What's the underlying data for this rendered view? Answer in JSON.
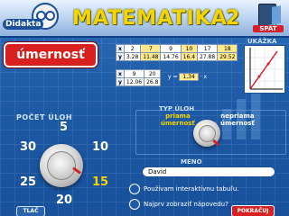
{
  "header": {
    "logo_text": "Didakta",
    "title": "MATEMATIKA",
    "number": "2",
    "exit_label": "SPÄŤ"
  },
  "topic": {
    "label": "úmernosť"
  },
  "example": {
    "table1": {
      "x_label": "x",
      "y_label": "y",
      "x_values": [
        "2",
        "7",
        "9",
        "10",
        "17",
        "18"
      ],
      "y_values": [
        "3.28",
        "11.48",
        "14.76",
        "16.4",
        "27.88",
        "29.52"
      ]
    },
    "table2": {
      "x_label": "x",
      "y_label": "y",
      "x_values": [
        "9",
        "20"
      ],
      "y_values": [
        "12.06",
        "26.8"
      ]
    },
    "formula": {
      "prefix": "y  =",
      "coefficient": "1,34",
      "suffix": "· x"
    }
  },
  "graph": {
    "label": "UKÁŽKA"
  },
  "count": {
    "label": "POČET ÚLOH",
    "options": [
      "5",
      "10",
      "15",
      "20",
      "25",
      "30"
    ],
    "selected": "15"
  },
  "type": {
    "label": "TYP ÚLOH",
    "left_line1": "priama",
    "left_line2": "úmernosť",
    "right_line1": "nepriama",
    "right_line2": "úmernosť"
  },
  "name": {
    "label": "MENO",
    "value": "David"
  },
  "options": {
    "whiteboard": "Používam interaktívnu tabuľu.",
    "hint": "Najprv zobraziť nápovedu?"
  },
  "footer": {
    "print_label": "TLAČ",
    "continue_label": "POKRAČUJ"
  },
  "colors": {
    "accent": "#f5d400",
    "danger": "#d61f2c",
    "bg": "#1e5aa6"
  }
}
